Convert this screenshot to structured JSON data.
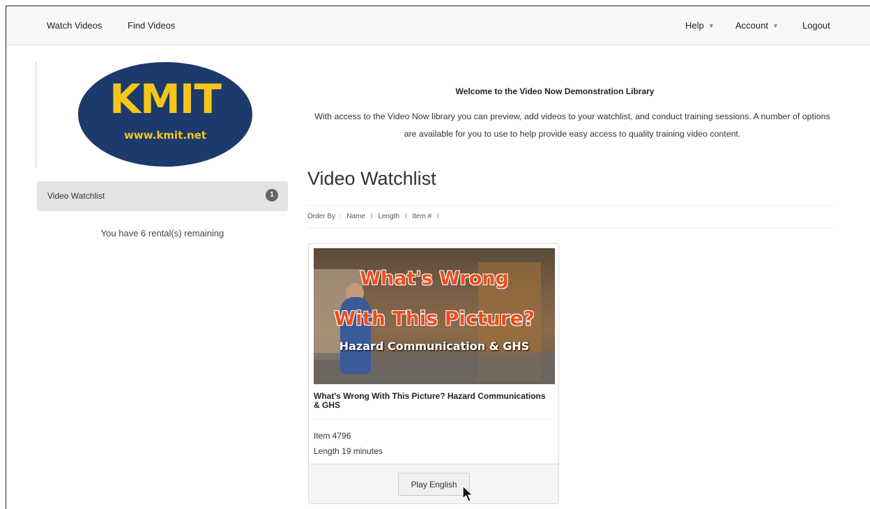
{
  "nav": {
    "watch_videos": "Watch Videos",
    "find_videos": "Find Videos",
    "help": "Help",
    "account": "Account",
    "logout": "Logout"
  },
  "logo": {
    "main": "KMIT",
    "url": "www.kmit.net",
    "colors": {
      "oval": "#1c3a6b",
      "text": "#f5c518"
    }
  },
  "sidebar": {
    "items": [
      {
        "label": "Video Watchlist",
        "badge": "1"
      }
    ],
    "rentals_text": "You have 6 rental(s) remaining"
  },
  "welcome": {
    "title": "Welcome to the Video Now Demonstration Library",
    "body": "With access to the Video Now library you can preview, add videos to your watchlist, and conduct training sessions. A number of options are available for you to use to help provide easy access to quality training video content."
  },
  "watchlist": {
    "title": "Video Watchlist",
    "order_by_label": "Order By",
    "order_options": [
      "Name",
      "Length",
      "Item #"
    ]
  },
  "video": {
    "thumb_line1": "What's Wrong",
    "thumb_line2": "With This Picture?",
    "thumb_line3": "Hazard Communication & GHS",
    "title": "What's Wrong With This Picture? Hazard Communications & GHS",
    "item": "Item 4796",
    "length": "Length 19 minutes",
    "play_label": "Play English"
  }
}
